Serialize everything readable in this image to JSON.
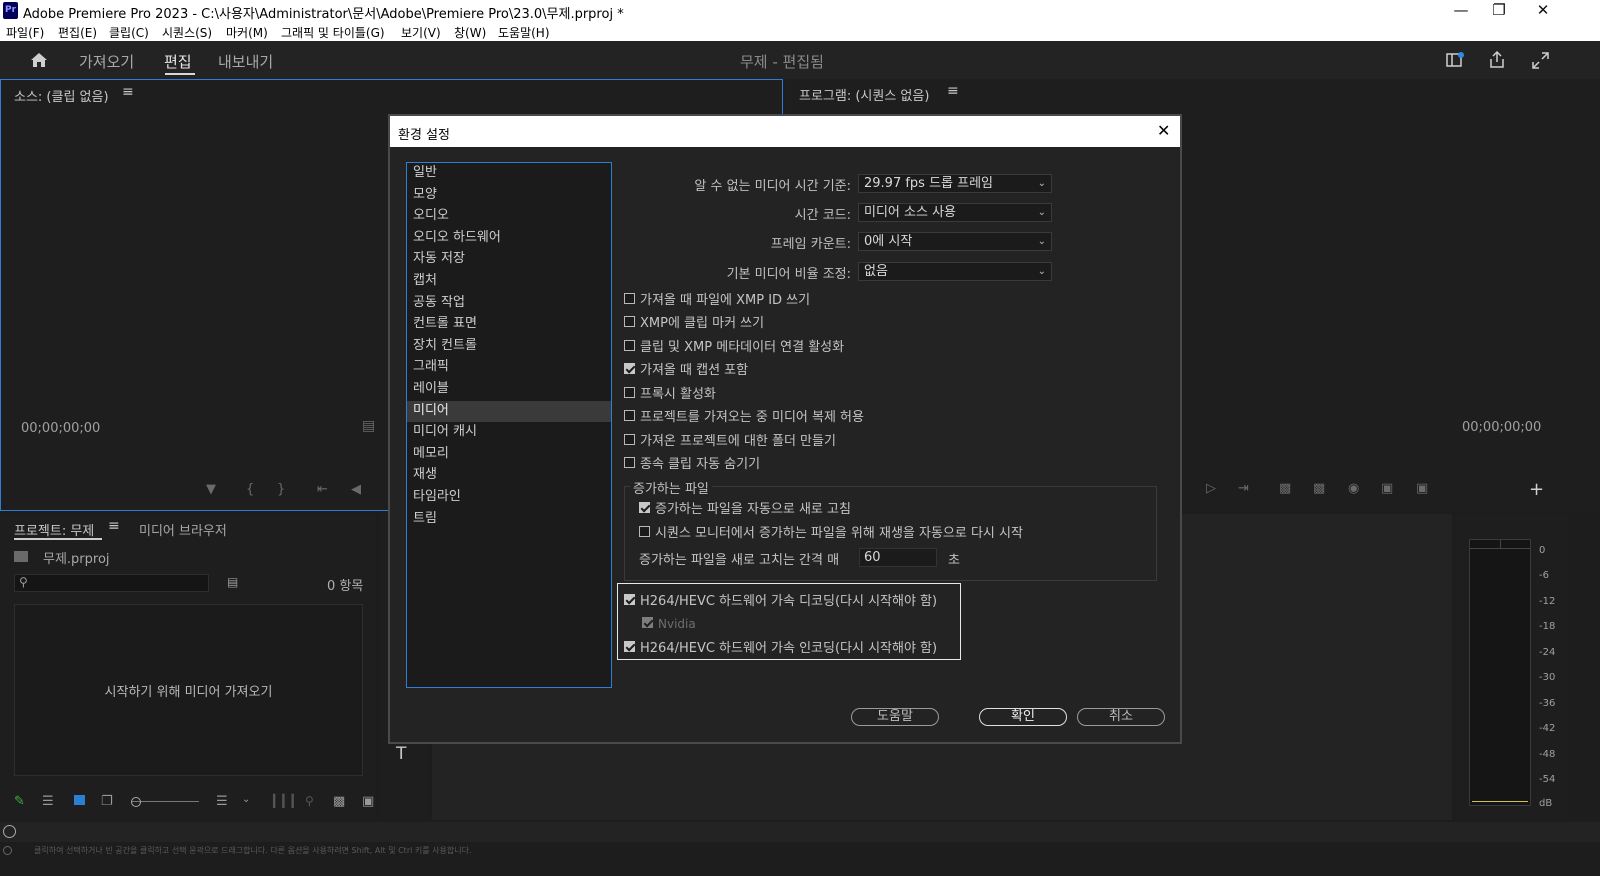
{
  "window": {
    "logo": "Pr",
    "title": "Adobe Premiere Pro 2023 - C:\\사용자\\Administrator\\문서\\Adobe\\Premiere Pro\\23.0\\무제.prproj *"
  },
  "menu": [
    "파일(F)",
    "편집(E)",
    "클립(C)",
    "시퀀스(S)",
    "마커(M)",
    "그래픽 및 타이틀(G)",
    "보기(V)",
    "창(W)",
    "도움말(H)"
  ],
  "workspace": {
    "tabs": [
      "가져오기",
      "편집",
      "내보내기"
    ],
    "active_tab": "편집",
    "project_title": "무제 - 편집됨"
  },
  "source_panel": {
    "title": "소스: (클립 없음)",
    "timecode": "00;00;00;00"
  },
  "program_panel": {
    "title": "프로그램: (시퀀스 없음)",
    "timecode": "00;00;00;00"
  },
  "project_panel": {
    "tab_project": "프로젝트: 무제",
    "tab_media_browser": "미디어 브라우저",
    "file_name": "무제.prproj",
    "item_count": "0 항목",
    "empty_message": "시작하기 위해 미디어 가져오기"
  },
  "audio_meter": {
    "labels": [
      "0",
      "-6",
      "-12",
      "-18",
      "-24",
      "-30",
      "-36",
      "-42",
      "-48",
      "-54",
      "dB"
    ]
  },
  "status_bar": {
    "text": "클릭하여 선택하거나 빈 공간을 클릭하고 선택 윤곽으로 드래그합니다. 다른 옵션을 사용하려면 Shift, Alt 및 Ctrl 키를 사용합니다."
  },
  "dialog": {
    "title": "환경 설정",
    "categories": [
      "일반",
      "모양",
      "오디오",
      "오디오 하드웨어",
      "자동 저장",
      "캡처",
      "공동 작업",
      "컨트롤 표면",
      "장치 컨트롤",
      "그래픽",
      "레이블",
      "미디어",
      "미디어 캐시",
      "메모리",
      "재생",
      "타임라인",
      "트림"
    ],
    "selected_category": "미디어",
    "fields": [
      {
        "label": "알 수 없는 미디어 시간 기준:",
        "value": "29.97 fps 드롭 프레임"
      },
      {
        "label": "시간 코드:",
        "value": "미디어 소스 사용"
      },
      {
        "label": "프레임 카운트:",
        "value": "0에 시작"
      },
      {
        "label": "기본 미디어 비율 조정:",
        "value": "없음"
      }
    ],
    "checkboxes": [
      {
        "label": "가져올 때 파일에 XMP ID 쓰기",
        "checked": false
      },
      {
        "label": "XMP에 클립 마커 쓰기",
        "checked": false
      },
      {
        "label": "클립 및 XMP 메타데이터 연결 활성화",
        "checked": false
      },
      {
        "label": "가져올 때 캡션 포함",
        "checked": true
      },
      {
        "label": "프록시 활성화",
        "checked": false
      },
      {
        "label": "프로젝트를 가져오는 중 미디어 복제 허용",
        "checked": false
      },
      {
        "label": "가져온 프로젝트에 대한 폴더 만들기",
        "checked": false
      },
      {
        "label": "종속 클립 자동 숨기기",
        "checked": false
      }
    ],
    "growing_files": {
      "legend": "증가하는 파일",
      "auto_refresh": {
        "label": "증가하는 파일을 자동으로 새로 고침",
        "checked": true
      },
      "auto_restart": {
        "label": "시퀀스 모니터에서 증가하는 파일을 위해 재생을 자동으로 다시 시작",
        "checked": false
      },
      "interval_label": "증가하는 파일을 새로 고치는 간격 매",
      "interval_value": "60",
      "interval_unit": "초"
    },
    "hardware": {
      "decode": {
        "label": "H264/HEVC 하드웨어 가속 디코딩(다시 시작해야 함)",
        "checked": true
      },
      "nvidia": {
        "label": "Nvidia",
        "checked": true
      },
      "encode": {
        "label": "H264/HEVC 하드웨어 가속 인코딩(다시 시작해야 함)",
        "checked": true
      }
    },
    "buttons": {
      "help": "도움말",
      "ok": "확인",
      "cancel": "취소"
    }
  }
}
